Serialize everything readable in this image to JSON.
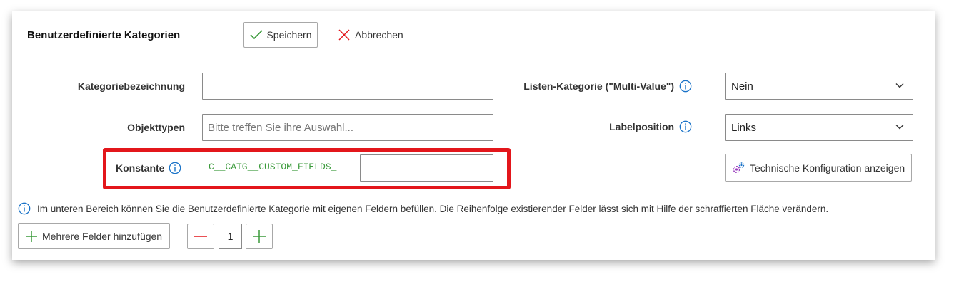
{
  "header": {
    "title": "Benutzerdefinierte Kategorien",
    "save_label": "Speichern",
    "cancel_label": "Abbrechen"
  },
  "form": {
    "category_name": {
      "label": "Kategoriebezeichnung",
      "value": ""
    },
    "object_types": {
      "label": "Objekttypen",
      "placeholder": "Bitte treffen Sie ihre Auswahl..."
    },
    "constant": {
      "label": "Konstante",
      "prefix": "C__CATG__CUSTOM_FIELDS_",
      "value": ""
    },
    "multi_value": {
      "label": "Listen-Kategorie (\"Multi-Value\")",
      "selected": "Nein"
    },
    "label_position": {
      "label": "Labelposition",
      "selected": "Links"
    },
    "tech_config_label": "Technische Konfiguration anzeigen"
  },
  "footer": {
    "info_text": "Im unteren Bereich können Sie die Benutzerdefinierte Kategorie mit eigenen Feldern befüllen. Die Reihenfolge existierender Felder lässt sich mit Hilfe der schraffierten Fläche verändern.",
    "add_fields_label": "Mehrere Felder hinzufügen",
    "field_count": "1"
  },
  "colors": {
    "accent_blue": "#1a73c8",
    "success_green": "#3a9a3a",
    "danger_red": "#e3161b",
    "gear_purple": "#9b3fbf"
  }
}
